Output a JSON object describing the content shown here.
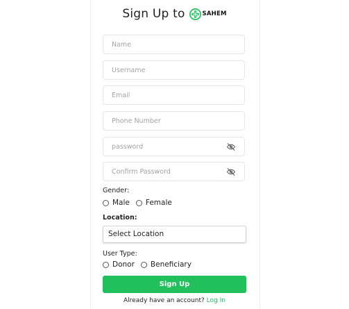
{
  "header": {
    "title": "Sign Up to",
    "logo_text": "SAHEM"
  },
  "form": {
    "name_placeholder": "Name",
    "username_placeholder": "Username",
    "email_placeholder": "Email",
    "phone_placeholder": "Phone Number",
    "password_placeholder": "password",
    "confirm_password_placeholder": "Confirm Password",
    "gender": {
      "label": "Gender:",
      "options": [
        "Male",
        "Female"
      ]
    },
    "location": {
      "label": "Location:",
      "selected": "Select Location"
    },
    "user_type": {
      "label": "User Type:",
      "options": [
        "Donor",
        "Beneficiary"
      ]
    },
    "submit_label": "Sign Up"
  },
  "footer": {
    "prompt": "Already have an account?",
    "login_link": "Log In"
  },
  "colors": {
    "accent": "#22bf5d",
    "border": "#e6e6e6",
    "placeholder": "#a3a3a3"
  },
  "icons": {
    "password_toggle": "eye-slash-icon",
    "logo": "medical-cross-logo"
  }
}
